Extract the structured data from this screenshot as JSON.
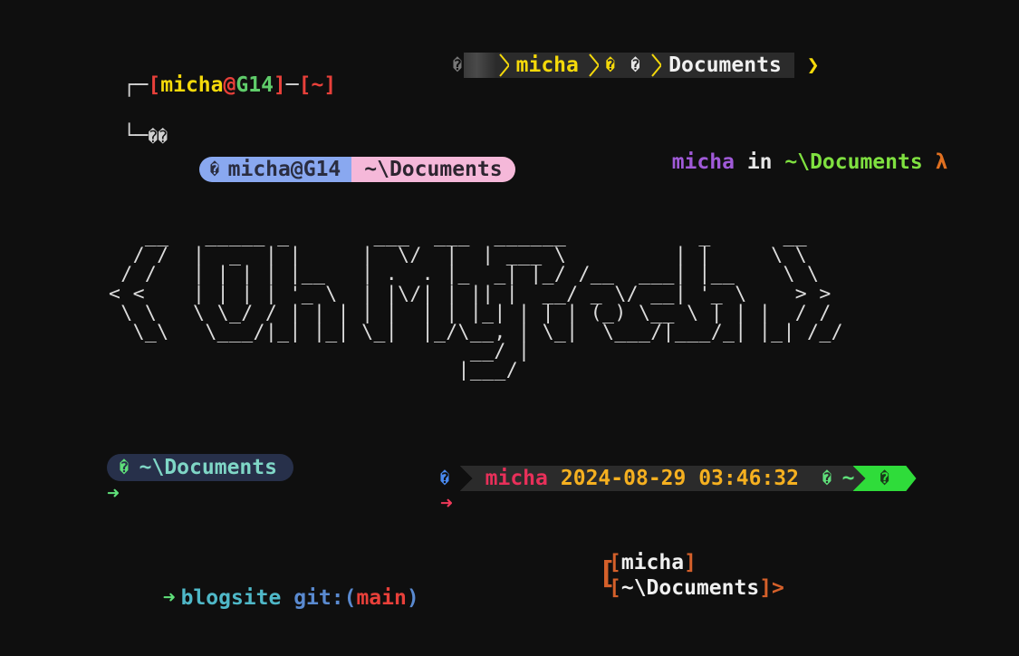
{
  "prompt_parrot": {
    "corner_top": "┌─",
    "open1": "[",
    "user": "micha",
    "at": "@",
    "host": "G14",
    "close1": "]",
    "dash": "─",
    "open2": "[",
    "path": "~",
    "close2": "]",
    "corner_bottom": "└─",
    "glyph": "��"
  },
  "prompt_powerline": {
    "lead_glyph": "�",
    "user": "micha",
    "icon1": "�",
    "icon2": "�",
    "folder": "Documents",
    "end": "❯"
  },
  "prompt_lambda": {
    "user": "micha",
    "in": "in",
    "path": "~\\Documents",
    "symbol": "λ"
  },
  "prompt_pill": {
    "icon": "�",
    "userhost": "micha@G14",
    "path": "~\\Documents"
  },
  "ascii_art": "   __   _____ _       ___  ___  ______           _      __ \n  / /  |  _  | |     |  \\/  |  | ___ \\         | |     \\ \\\n / /   | | | | |__   | .  . |_  _| |_/ /__  ___| |__    \\ \\\n< <    | | | | '_ \\  | |\\/| | || |  __/ _ \\/ __| '_ \\    > >\n \\ \\   \\ \\_/ / | | | | |  | | |_| | | | (_) \\__ \\ | | |  / /\n  \\_\\   \\___/|_| |_| \\_|  |_/\\__, | \\_|  \\___/|___/_| |_| /_/\n                              __/ |\n                             |___/",
  "prompt_bubble": {
    "icon": "�",
    "path": "~\\Documents",
    "arrow": "➜"
  },
  "prompt_datetime": {
    "lead_glyph": "�",
    "user": "micha",
    "datetime": "2024-08-29 03:46:32",
    "icon": "�",
    "tilde": "~",
    "end_glyph": "�",
    "arrow": "➜"
  },
  "prompt_git": {
    "arrow": "➜",
    "dir": "blogsite",
    "git_label": "git:",
    "open": "(",
    "branch": "main",
    "close": ")"
  },
  "prompt_brackets": {
    "big": "[",
    "open1": "[",
    "user": "micha",
    "close1": "]",
    "open2": "[",
    "path": "~\\Documents",
    "close2": "]",
    "end": ">"
  },
  "colors": {
    "background": "#0f0f0f",
    "yellow": "#f5d90a",
    "purple": "#a05ad8",
    "green": "#5fe07a",
    "red": "#e8403a",
    "orange": "#d4602a",
    "pink": "#f5b8d9",
    "blue": "#89a8f0",
    "teal": "#7fd6c6"
  }
}
